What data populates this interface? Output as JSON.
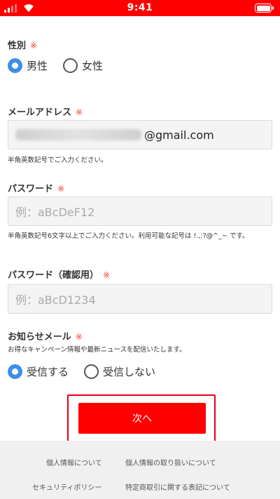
{
  "status_bar": {
    "time": "9:41"
  },
  "gender": {
    "label": "性別",
    "required_mark": "※",
    "options": [
      {
        "label": "男性",
        "checked": true
      },
      {
        "label": "女性",
        "checked": false
      }
    ]
  },
  "email": {
    "label": "メールアドレス",
    "required_mark": "※",
    "value_visible": "@gmail.com",
    "hint": "半角英数記号でご入力ください。"
  },
  "password": {
    "label": "パスワード",
    "required_mark": "※",
    "placeholder": "例：aBcDeF12",
    "hint": "半角英数記号6文字以上でご入力ください。利用可能な記号は !.,:?@^_~ です。"
  },
  "password_confirm": {
    "label": "パスワード（確認用）",
    "required_mark": "※",
    "placeholder": "例：aBcD1234"
  },
  "newsletter": {
    "label": "お知らせメール",
    "required_mark": "※",
    "description": "お得なキャンペーン情報や最新ニュースを配信いたします。",
    "options": [
      {
        "label": "受信する",
        "checked": true
      },
      {
        "label": "受信しない",
        "checked": false
      }
    ]
  },
  "next_button": {
    "label": "次へ"
  },
  "footer": {
    "links": [
      "個人情報について",
      "個人情報の取り扱いについて",
      "セキュリティポリシー",
      "特定商取引に関する表記について"
    ]
  },
  "colors": {
    "brand_red": "#ff0000",
    "radio_blue": "#3b8fe8"
  }
}
